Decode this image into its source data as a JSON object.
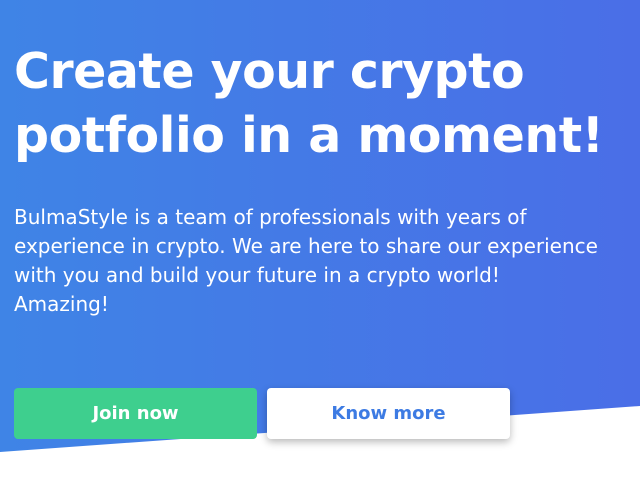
{
  "hero": {
    "title_line_1": "Create your crypto",
    "title_line_2": "potfolio in a moment!",
    "subtitle_lines": [
      "BulmaStyle is a team of professionals with years of",
      "experience in crypto. We are here to share our experience",
      "with you and build your future in a crypto world!",
      "Amazing!"
    ]
  },
  "buttons": {
    "primary_label": "Join now",
    "secondary_label": "Know more"
  },
  "colors": {
    "gradient_start": "#3f82e6",
    "gradient_end": "#4a6ee8",
    "primary_button": "#3ecf8e",
    "secondary_text": "#3d7be3",
    "text_on_hero": "#ffffff"
  }
}
